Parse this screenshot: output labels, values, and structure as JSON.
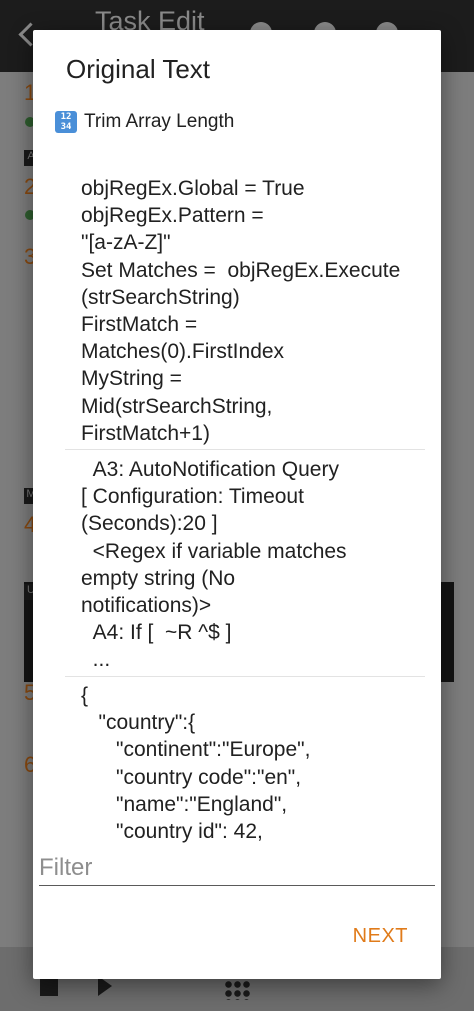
{
  "background": {
    "app_title": "Task Edit",
    "visible_numbers": [
      "1",
      "2",
      "3",
      "4",
      "5",
      "6"
    ],
    "labels": [
      "A",
      "M",
      "U"
    ]
  },
  "dialog": {
    "title": "Original Text",
    "subtitle_icon": "input-numbers-icon",
    "subtitle_icon_text_top": "12",
    "subtitle_icon_text_bottom": "34",
    "subtitle": "Trim Array Length",
    "items": [
      {
        "text": "objRegEx.Global = True\nobjRegEx.Pattern =\n\"[a-zA-Z]\"\nSet Matches =  objRegEx.Execute(strSearchString)\nFirstMatch =\nMatches(0).FirstIndex\nMyString =\nMid(strSearchString,\nFirstMatch+1)"
      },
      {
        "text": "  A3: AutoNotification Query\n[ Configuration: Timeout\n(Seconds):20 ]\n  <Regex if variable matches\nempty string (No\nnotifications)>\n  A4: If [  ~R ^$ ]\n  ..."
      },
      {
        "text": "{\n   \"country\":{\n      \"continent\":\"Europe\",\n      \"country code\":\"en\",\n      \"name\":\"England\",\n      \"country id\": 42,"
      }
    ],
    "filter_placeholder": "Filter",
    "filter_value": "",
    "next_label": "NEXT"
  },
  "colors": {
    "accent": "#e07b1a",
    "scrim": "#7a7a7a",
    "dialog_bg": "#ffffff"
  }
}
